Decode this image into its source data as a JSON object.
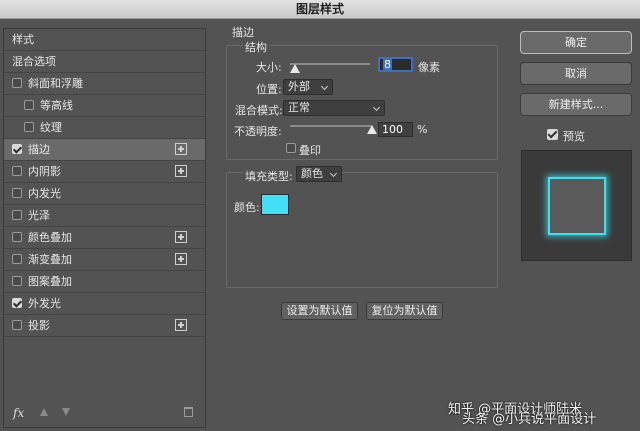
{
  "window": {
    "title": "图层样式"
  },
  "styles_panel": {
    "items": [
      {
        "label": "样式",
        "checkbox": false,
        "checked": false,
        "plus": false,
        "indent": false,
        "selected": false
      },
      {
        "label": "混合选项",
        "checkbox": false,
        "checked": false,
        "plus": false,
        "indent": false,
        "selected": false
      },
      {
        "label": "斜面和浮雕",
        "checkbox": true,
        "checked": false,
        "plus": false,
        "indent": false,
        "selected": false
      },
      {
        "label": "等高线",
        "checkbox": true,
        "checked": false,
        "plus": false,
        "indent": true,
        "selected": false
      },
      {
        "label": "纹理",
        "checkbox": true,
        "checked": false,
        "plus": false,
        "indent": true,
        "selected": false
      },
      {
        "label": "描边",
        "checkbox": true,
        "checked": true,
        "plus": true,
        "indent": false,
        "selected": true
      },
      {
        "label": "内阴影",
        "checkbox": true,
        "checked": false,
        "plus": true,
        "indent": false,
        "selected": false
      },
      {
        "label": "内发光",
        "checkbox": true,
        "checked": false,
        "plus": false,
        "indent": false,
        "selected": false
      },
      {
        "label": "光泽",
        "checkbox": true,
        "checked": false,
        "plus": false,
        "indent": false,
        "selected": false
      },
      {
        "label": "颜色叠加",
        "checkbox": true,
        "checked": false,
        "plus": true,
        "indent": false,
        "selected": false
      },
      {
        "label": "渐变叠加",
        "checkbox": true,
        "checked": false,
        "plus": true,
        "indent": false,
        "selected": false
      },
      {
        "label": "图案叠加",
        "checkbox": true,
        "checked": false,
        "plus": false,
        "indent": false,
        "selected": false
      },
      {
        "label": "外发光",
        "checkbox": true,
        "checked": true,
        "plus": false,
        "indent": false,
        "selected": false
      },
      {
        "label": "投影",
        "checkbox": true,
        "checked": false,
        "plus": true,
        "indent": false,
        "selected": false
      }
    ],
    "fx_label": "fx"
  },
  "stroke": {
    "section_title": "描边",
    "structure_title": "结构",
    "size_label": "大小:",
    "size_value": "8",
    "size_unit": "像素",
    "position_label": "位置:",
    "position_value": "外部",
    "blend_label": "混合模式:",
    "blend_value": "正常",
    "opacity_label": "不透明度:",
    "opacity_value": "100",
    "opacity_unit": "%",
    "overprint_label": "叠印",
    "fill_type_label": "填充类型:",
    "fill_type_value": "颜色",
    "color_label": "颜色:",
    "color_value": "#43e0f5",
    "set_default_label": "设置为默认值",
    "reset_default_label": "复位为默认值"
  },
  "actions": {
    "ok_label": "确定",
    "cancel_label": "取消",
    "new_style_label": "新建样式...",
    "preview_label": "预览"
  },
  "watermark": {
    "line1": "知乎 @平面设计师陆米",
    "line2": "头条 @小兵说平面设计"
  }
}
